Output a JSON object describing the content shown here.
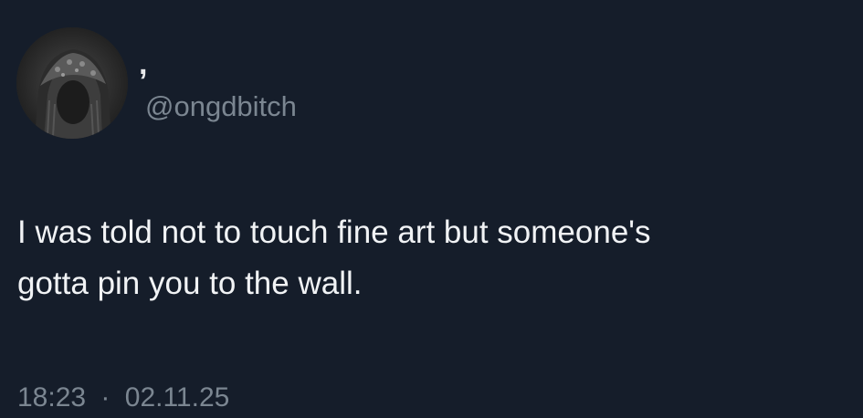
{
  "author": {
    "display_name": ",",
    "handle": "@ongdbitch"
  },
  "tweet": {
    "text": "I was told not to touch fine art but someone's\ngotta pin you to the wall.",
    "time": "18:23",
    "separator": "·",
    "date": "02.11.25"
  },
  "colors": {
    "background": "#151d2a",
    "text": "#f1f3f5",
    "secondary_text": "#7b8691"
  },
  "icons": {
    "avatar": "avatar-photo"
  }
}
